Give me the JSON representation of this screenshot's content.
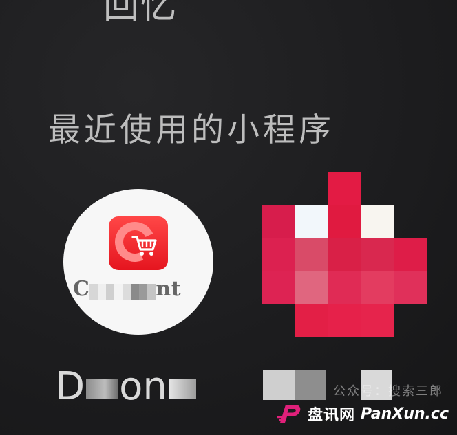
{
  "header": {
    "clipped_title": "回忆"
  },
  "section": {
    "title": "最近使用的小程序"
  },
  "mini_programs": [
    {
      "name_prefix": "C",
      "name_suffix": "nt",
      "logo_color": "#e5151f",
      "icon": "shopping-cart-icon"
    },
    {
      "icon": "pixelated-logo",
      "logo_color": "#e0214f"
    }
  ],
  "bottom_labels": {
    "first_prefix": "D",
    "first_suffix": "on"
  },
  "watermark": {
    "faint_text": "公众号：搜索三郎",
    "cn_text": "盘讯网",
    "en_text": "PanXun.cc",
    "logo_color": "#e0207a"
  }
}
